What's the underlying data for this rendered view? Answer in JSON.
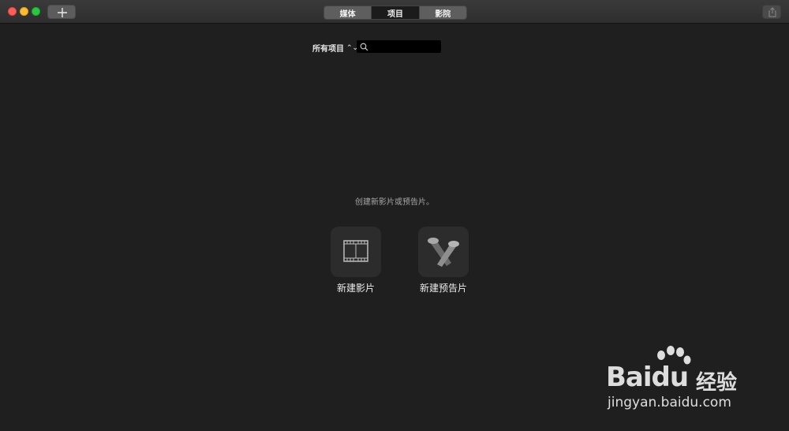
{
  "toolbar": {
    "window_controls": [
      "close",
      "minimize",
      "zoom"
    ],
    "add_icon": "plus-icon",
    "tabs": [
      {
        "label": "媒体",
        "active": false
      },
      {
        "label": "项目",
        "active": true
      },
      {
        "label": "影院",
        "active": false
      }
    ],
    "share_icon": "share-icon"
  },
  "filter": {
    "label": "所有项目",
    "search_placeholder": "",
    "search_value": ""
  },
  "empty_state": {
    "prompt": "创建新影片或预告片。",
    "tiles": [
      {
        "label": "新建影片",
        "icon": "film-strip-icon"
      },
      {
        "label": "新建预告片",
        "icon": "spotlights-icon"
      }
    ]
  },
  "watermark": {
    "logo_text_a": "Bai",
    "logo_text_b": "du",
    "logo_cn": "经验",
    "url": "jingyan.baidu.com"
  }
}
